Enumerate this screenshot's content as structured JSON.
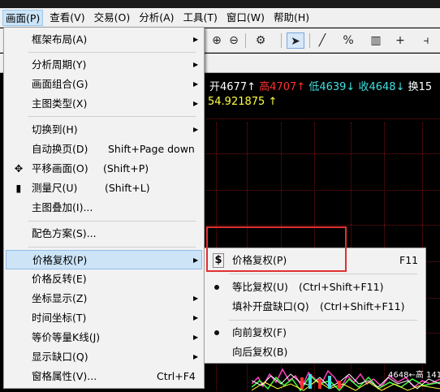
{
  "menubar": {
    "items": [
      {
        "label": "画面(P)"
      },
      {
        "label": "查看(V)"
      },
      {
        "label": "交易(O)"
      },
      {
        "label": "分析(A)"
      },
      {
        "label": "工具(T)"
      },
      {
        "label": "窗口(W)"
      },
      {
        "label": "帮助(H)"
      }
    ]
  },
  "toolbar": {
    "zoom_in": "⊕",
    "zoom_out": "⊖",
    "settings": "⚙",
    "cursor": "➤",
    "line": "╱",
    "percent": "%",
    "bars": "▥",
    "plus": "+",
    "tail": "⫞"
  },
  "quote": {
    "open_label": "开",
    "open_value": "4677",
    "high_label": "高",
    "high_value": "4707",
    "low_label": "低",
    "low_value": "4639",
    "close_label": "收",
    "close_value": "4648",
    "turnover_label": "换15"
  },
  "ma_value": "54.921875",
  "bottom_text": "4648←高 141",
  "main_menu": {
    "items": [
      {
        "label": "框架布局(A)",
        "submenu": true
      },
      {
        "label": "分析周期(Y)",
        "submenu": true
      },
      {
        "label": "画面组合(G)",
        "submenu": true
      },
      {
        "label": "主图类型(X)",
        "submenu": true
      },
      {
        "label": "切换到(H)",
        "submenu": true
      },
      {
        "label": "自动换页(D)",
        "shortcut": "Shift+Page down"
      },
      {
        "label": "平移画面(O)",
        "shortcut": "(Shift+P)",
        "icon": "move-icon"
      },
      {
        "label": "测量尺(U)",
        "shortcut": "(Shift+L)",
        "icon": "ruler-icon"
      },
      {
        "label": "主图叠加(I)..."
      },
      {
        "label": "配色方案(S)..."
      },
      {
        "label": "价格复权(P)",
        "submenu": true
      },
      {
        "label": "价格反转(E)"
      },
      {
        "label": "坐标显示(Z)",
        "submenu": true
      },
      {
        "label": "时间坐标(T)",
        "submenu": true
      },
      {
        "label": "等价等量K线(J)",
        "submenu": true
      },
      {
        "label": "显示缺口(Q)",
        "submenu": true
      },
      {
        "label": "窗格属性(V)...",
        "shortcut": "Ctrl+F4"
      }
    ]
  },
  "sub_menu": {
    "items": [
      {
        "label": "价格复权(P)",
        "shortcut": "F11",
        "icon": "$"
      },
      {
        "label": "等比复权(U)",
        "shortcut": "(Ctrl+Shift+F11)",
        "checked": true
      },
      {
        "label": "填补开盘缺口(Q)",
        "shortcut": "(Ctrl+Shift+F11)"
      },
      {
        "label": "向前复权(F)",
        "checked": true
      },
      {
        "label": "向后复权(B)"
      }
    ]
  }
}
